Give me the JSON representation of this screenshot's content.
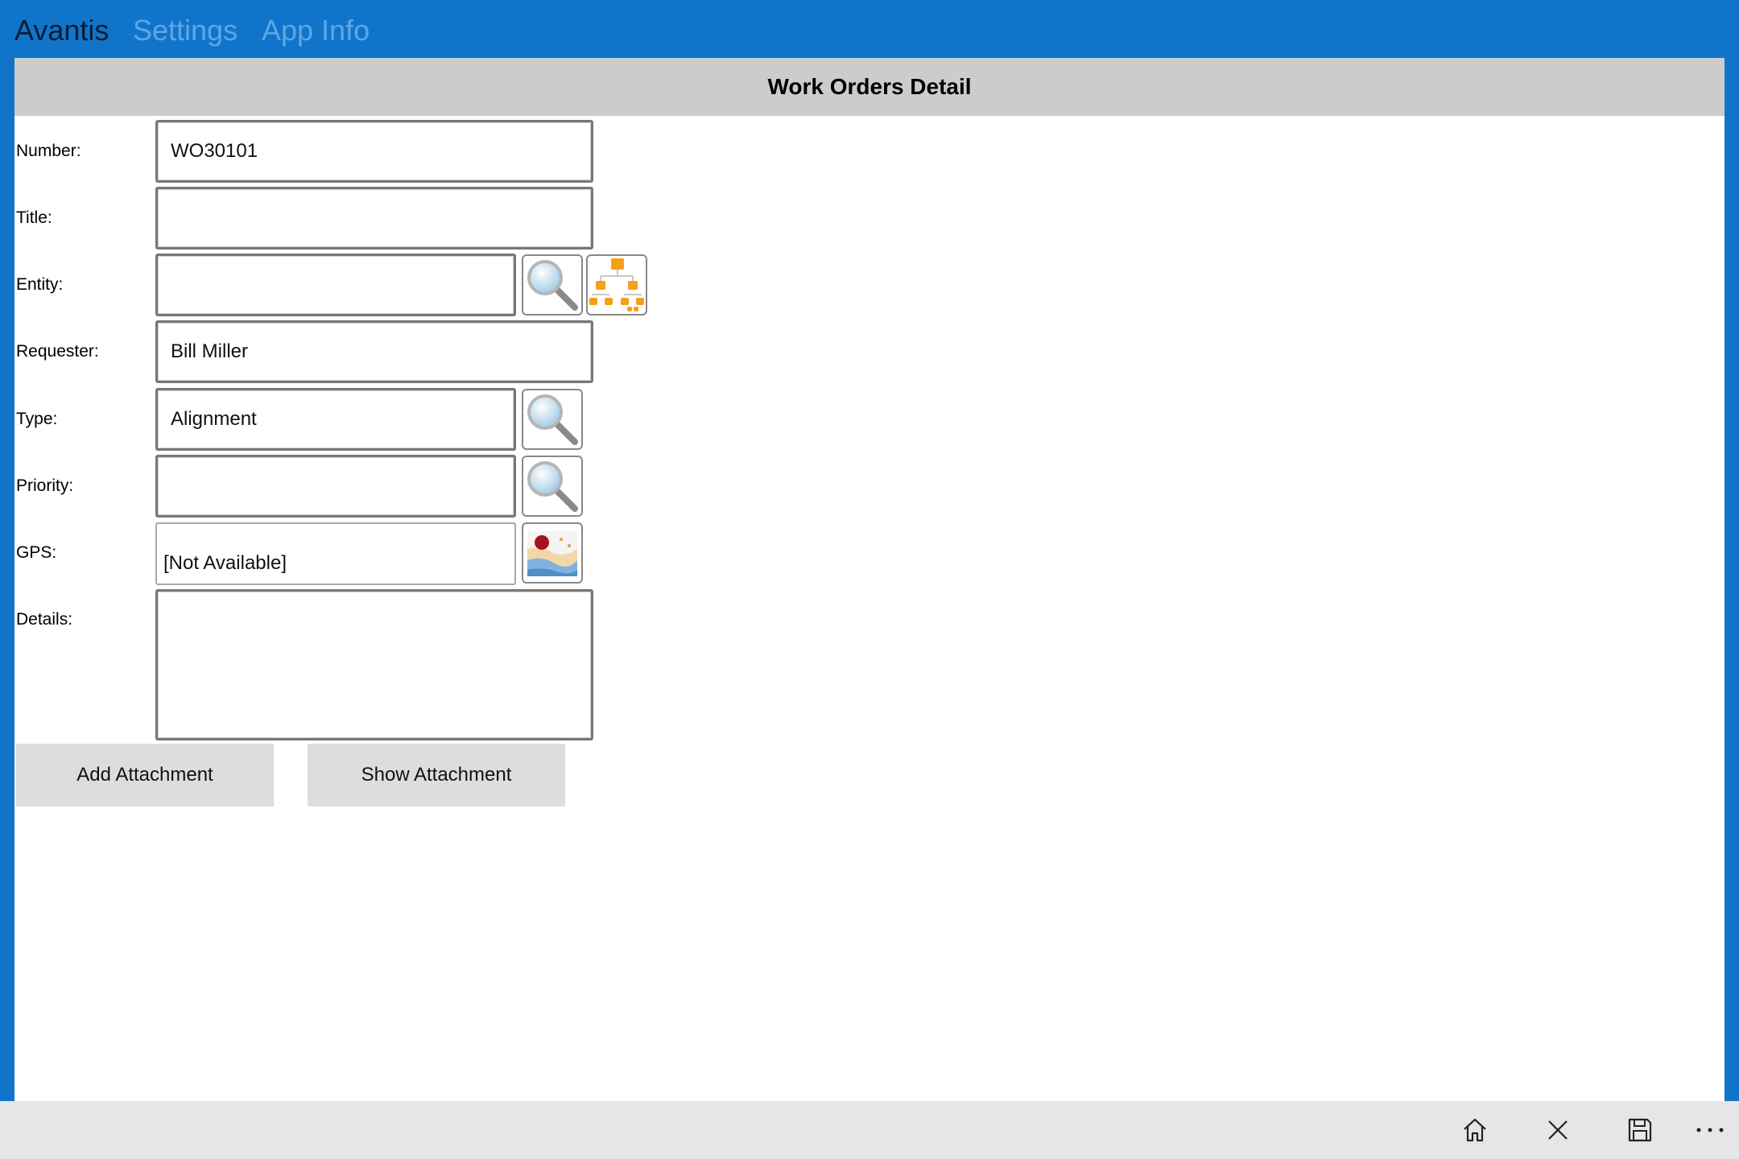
{
  "nav": {
    "tabs": [
      {
        "label": "Avantis",
        "active": true
      },
      {
        "label": "Settings",
        "active": false
      },
      {
        "label": "App Info",
        "active": false
      }
    ]
  },
  "page": {
    "title": "Work Orders Detail"
  },
  "form": {
    "number": {
      "label": "Number:",
      "value": "WO30101"
    },
    "title": {
      "label": "Title:",
      "value": ""
    },
    "entity": {
      "label": "Entity:",
      "value": ""
    },
    "requester": {
      "label": "Requester:",
      "value": "Bill Miller"
    },
    "type": {
      "label": "Type:",
      "value": "Alignment"
    },
    "priority": {
      "label": "Priority:",
      "value": ""
    },
    "gps": {
      "label": "GPS:",
      "value": "[Not Available]"
    },
    "details": {
      "label": "Details:",
      "value": ""
    }
  },
  "actions": {
    "add_attachment": "Add Attachment",
    "show_attachment": "Show Attachment"
  },
  "icons": {
    "lookup": "magnifier-icon",
    "hierarchy": "hierarchy-icon",
    "map": "map-icon",
    "home": "home-icon",
    "close": "close-icon",
    "save": "save-icon",
    "more": "more-icon"
  },
  "colors": {
    "accent": "#1075ca",
    "header_bg": "#cccccc",
    "button_bg": "#dddddd",
    "hierarchy_orange": "#f5a01a"
  }
}
